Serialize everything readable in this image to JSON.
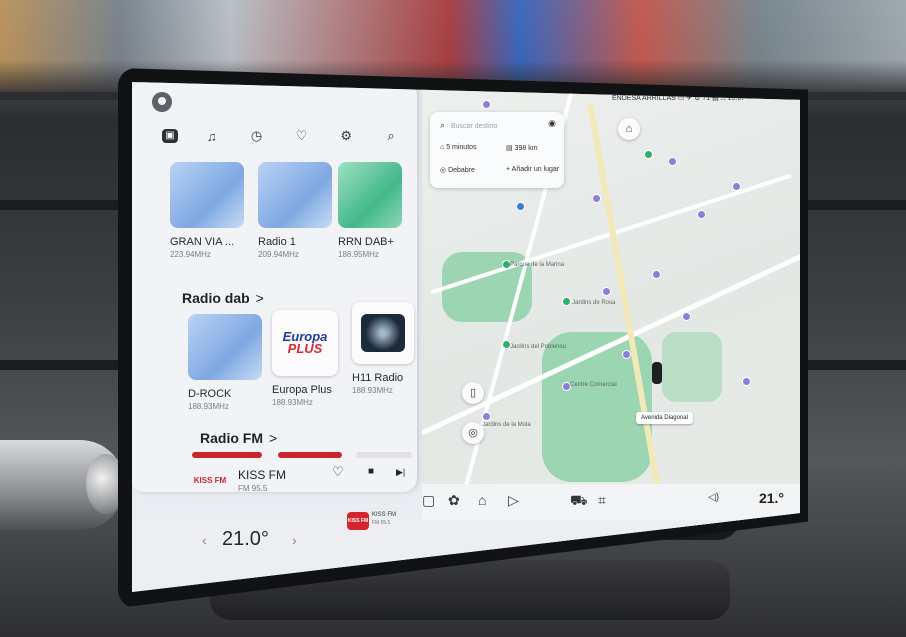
{
  "media": {
    "toolbar": [
      "▣",
      "♫",
      "◷",
      "♡",
      "⚙",
      "⌕"
    ],
    "recent": [
      {
        "name": "GRAN VIA ...",
        "freq": "223.94MHz",
        "art": "blue"
      },
      {
        "name": "Radio 1",
        "freq": "209.94MHz",
        "art": "blue"
      },
      {
        "name": "RRN DAB+",
        "freq": "188.95MHz",
        "art": "green"
      }
    ],
    "section_dab": "Radio dab",
    "dab": [
      {
        "name": "D-ROCK",
        "freq": "188.93MHz"
      },
      {
        "name": "Europa Plus",
        "freq": "188.93MHz",
        "logo_top": "Europa",
        "logo_bottom": "PLUS"
      },
      {
        "name": "H11 Radio",
        "freq": "188.93MHz"
      }
    ],
    "section_fm": "Radio FM",
    "chevron": ">",
    "now_playing": {
      "title": "KISS FM",
      "sub": "FM 95.5",
      "logo": "KISS FM"
    },
    "controls": {
      "fav": "♡",
      "stop": "■",
      "next": "▶|"
    }
  },
  "map": {
    "search_placeholder": "Buscar destino",
    "shortcuts": [
      {
        "icon": "⌂",
        "label": "5 minutos"
      },
      {
        "icon": "▤",
        "label": "398 km"
      },
      {
        "icon": "◎",
        "label": "Debabre"
      },
      {
        "icon": "+",
        "label": "Añadir un lugar"
      }
    ],
    "status": "ENDESA ARRILLAS  ▭ ✈ ⚙ 71 ▤ ⎍ 15:07",
    "street_chip": "Avenida Diagonal",
    "labels": [
      "Parque de la Marina",
      "Jardins de Rosa",
      "Jardins del Poblenou",
      "Jardins de la Mola",
      "Centre Comercial"
    ]
  },
  "dock": {
    "icons": [
      "▢",
      "✿",
      "⌂",
      "▷",
      "⛟",
      "⌗"
    ],
    "volume": "◁)",
    "temp_right": "21.°"
  },
  "bottom": {
    "temp_left": "21.0°",
    "left_arrow": "‹",
    "right_arrow": "›",
    "mini_logo": "KISS FM",
    "mini_name": "KISS FM",
    "mini_sub": "FM 95.5"
  }
}
